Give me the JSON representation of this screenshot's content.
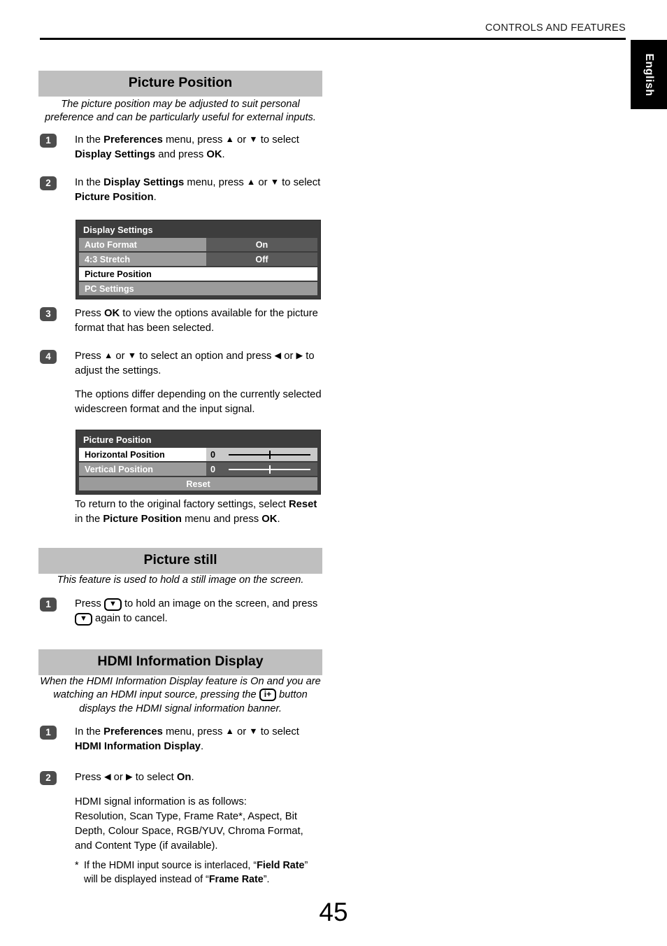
{
  "header": {
    "running_head": "CONTROLS AND FEATURES",
    "language_tab": "English"
  },
  "sections": [
    {
      "title": "Picture Position",
      "intro": "The picture position may be adjusted to suit personal preference and can be particularly useful for external inputs.",
      "steps": [
        {
          "number": "1",
          "text_parts": [
            "In the ",
            "Preferences",
            " menu, press ",
            "▲",
            " or ",
            "▼",
            " to select ",
            "Display Settings",
            " and press ",
            "OK",
            "."
          ]
        },
        {
          "number": "2",
          "text_parts": [
            "In the ",
            "Display Settings",
            " menu, press ",
            "▲",
            " or ",
            "▼",
            " to select ",
            "Picture Position",
            "."
          ]
        },
        {
          "number": "3",
          "text_parts": [
            "Press ",
            "OK",
            " to view the options available for the picture format that has been selected."
          ]
        },
        {
          "number": "4",
          "text_parts": [
            "Press ",
            "▲",
            " or ",
            "▼",
            " to select an option and press ",
            "◀",
            " or ",
            "▶",
            " to adjust the settings."
          ]
        }
      ],
      "step4_note": "The options differ depending on the currently selected widescreen format and the input signal.",
      "reset_note_parts": [
        "To return to the original factory settings, select ",
        "Reset",
        " in the ",
        "Picture Position",
        " menu and press ",
        "OK",
        "."
      ]
    },
    {
      "title": "Picture still",
      "intro": "This feature is used to hold a still image on the screen.",
      "step": {
        "number": "1",
        "part_a": "Press ",
        "keycap": "▼",
        "part_b": " to hold an image on the screen, and press ",
        "part_c": " again to cancel."
      }
    },
    {
      "title": "HDMI Information Display",
      "intro_a": "When the HDMI Information Display feature is On and you are watching an HDMI input source, pressing the ",
      "intro_keycap": "i+",
      "intro_b": " button displays the HDMI signal information banner.",
      "steps": [
        {
          "number": "1",
          "text_parts": [
            "In the ",
            "Preferences",
            " menu, press ",
            "▲",
            " or ",
            "▼",
            " to select ",
            "HDMI Information Display",
            "."
          ]
        },
        {
          "number": "2",
          "text_parts": [
            "Press ",
            "◀",
            " or ",
            "▶",
            " to select ",
            "On",
            "."
          ]
        }
      ],
      "signal_info_heading": "HDMI signal information is as follows:",
      "signal_info_list": "Resolution, Scan Type, Frame Rate*, Aspect, Bit Depth, Colour Space, RGB/YUV, Chroma Format, and Content Type (if available).",
      "footnote": {
        "star": "*",
        "part_a": "If the HDMI input source is interlaced, “",
        "bold_a": "Field Rate",
        "part_b": "” will be displayed instead of “",
        "bold_b": "Frame Rate",
        "part_c": "”."
      }
    }
  ],
  "osd_display_settings": {
    "title": "Display Settings",
    "rows": [
      {
        "label": "Auto Format",
        "value": "On",
        "label_style": "gray",
        "value_style": "dark"
      },
      {
        "label": "4:3 Stretch",
        "value": "Off",
        "label_style": "gray",
        "value_style": "dark"
      },
      {
        "label": "Picture Position",
        "value": "",
        "label_style": "white",
        "value_style": "none"
      },
      {
        "label": "PC Settings",
        "value": "",
        "label_style": "gray",
        "value_style": "none"
      }
    ]
  },
  "osd_picture_position": {
    "title": "Picture Position",
    "rows": [
      {
        "label": "Horizontal Position",
        "value": "0",
        "label_style": "white",
        "value_style": "light"
      },
      {
        "label": "Vertical Position",
        "value": "0",
        "label_style": "gray",
        "value_style": "dark"
      }
    ],
    "reset_label": "Reset"
  },
  "page_number": "45",
  "colors": {
    "section_bar": "#bfbfbf",
    "badge": "#4d4d4d",
    "osd_background": "#3d3d3d",
    "osd_label_gray": "#9b9b9b",
    "osd_value_dark": "#5a5a5a",
    "osd_value_light": "#c9c9c9"
  }
}
